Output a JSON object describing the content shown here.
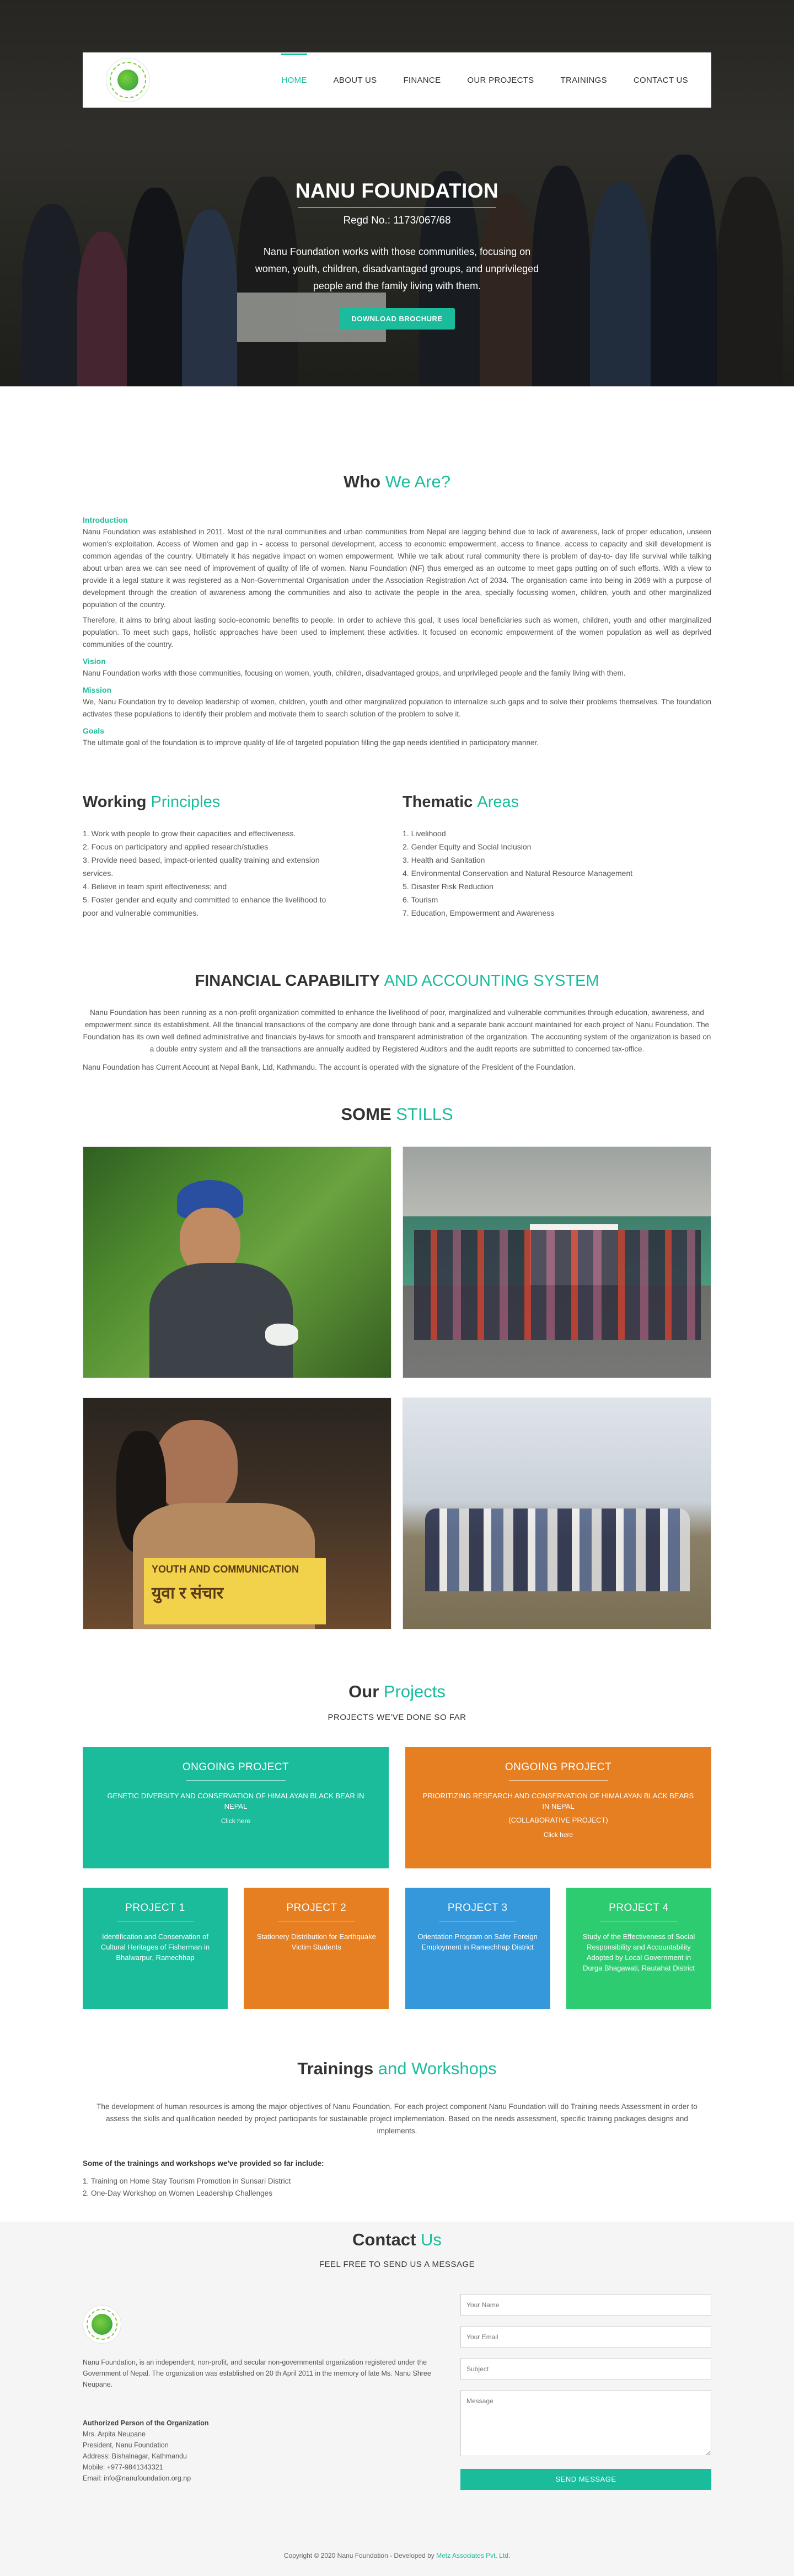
{
  "nav": {
    "items": [
      {
        "label": "HOME",
        "active": true
      },
      {
        "label": "ABOUT US",
        "active": false
      },
      {
        "label": "FINANCE",
        "active": false
      },
      {
        "label": "OUR PROJECTS",
        "active": false
      },
      {
        "label": "TRAININGS",
        "active": false
      },
      {
        "label": "CONTACT US",
        "active": false
      }
    ]
  },
  "hero": {
    "title": "NANU FOUNDATION",
    "regd": "Regd No.: 1173/067/68",
    "text": "Nanu Foundation works with those communities, focusing on women, youth, children, disadvantaged groups, and unprivileged people and the family living with them.",
    "button": "DOWNLOAD BROCHURE"
  },
  "who": {
    "title_a": "Who ",
    "title_b": "We Are?",
    "intro_h": "Introduction",
    "intro_p1": "Nanu Foundation was established in 2011. Most of the rural communities and urban communities from Nepal are lagging behind due to lack of awareness, lack of proper education, unseen women's exploitation. Access of Women and gap in - access to personal development, access to economic empowerment, access to finance, access to capacity and skill development is common agendas of the country. Ultimately it has negative impact on women empowerment. While we talk about rural community there is problem of day-to- day life survival while talking about urban area we can see need of improvement of quality of life of women. Nanu Foundation (NF) thus emerged as an outcome to meet gaps putting on of such efforts. With a view to provide it a legal stature it was registered as a Non-Governmental Organisation under the Association Registration Act of 2034. The organisation came into being in 2069 with a purpose of development through the creation of awareness among the communities and also to activate the people in the area, specially focussing women, children, youth and other marginalized population of the country.",
    "intro_p2": "Therefore, it aims to bring about lasting socio-economic benefits to people. In order to achieve this goal, it uses local beneficiaries such as women, children, youth and other marginalized population. To meet such gaps, holistic approaches have been used to implement these activities. It focused on economic empowerment of the women population as well as deprived communities of the country.",
    "vision_h": "Vision",
    "vision_p": "Nanu Foundation works with those communities, focusing on women, youth, children, disadvantaged groups, and unprivileged people and the family living with them.",
    "mission_h": "Mission",
    "mission_p": "We, Nanu Foundation try to develop leadership of women, children, youth and other marginalized population to internalize such gaps and to solve their problems themselves. The foundation activates these populations to identify their problem and motivate them to search solution of the problem to solve it.",
    "goals_h": "Goals",
    "goals_p": "The ultimate goal of the foundation is to improve quality of life of targeted population filling the gap needs identified in participatory manner."
  },
  "principles": {
    "title_a": "Working ",
    "title_b": "Principles",
    "items": [
      "1. Work with people to grow their capacities and effectiveness.",
      "2. Focus on participatory and applied research/studies",
      "3. Provide need based, impact-oriented quality training and extension services.",
      "4. Believe in team spirit effectiveness; and",
      "5. Foster gender and equity and committed to enhance the livelihood to poor and vulnerable communities."
    ]
  },
  "thematic": {
    "title_a": "Thematic ",
    "title_b": "Areas",
    "items": [
      "1. Livelihood",
      "2. Gender Equity and Social Inclusion",
      "3. Health and Sanitation",
      "4. Environmental Conservation and Natural Resource Management",
      "5. Disaster Risk Reduction",
      "6. Tourism",
      "7. Education, Empowerment and Awareness"
    ]
  },
  "finance": {
    "title_a": "FINANCIAL CAPABILITY ",
    "title_b": "AND ACCOUNTING SYSTEM",
    "p1": "Nanu Foundation has been running as a non-profit organization committed to enhance the livelihood of poor, marginalized and vulnerable communities through education, awareness, and empowerment since its establishment. All the financial transactions of the company are done through bank and a separate bank account maintained for each project of Nanu Foundation. The Foundation has its own well defined administrative and financials by-laws for smooth and transparent administration of the organization. The accounting system of the organization is based on a double entry system and all the transactions are annually audited by Registered Auditors and the audit reports are submitted to concerned tax-office.",
    "p2": "Nanu Foundation has Current Account at Nepal Bank, Ltd, Kathmandu. The account is operated with the signature of the President of the Foundation."
  },
  "stills": {
    "title_a": "SOME ",
    "title_b": "STILLS",
    "sign_text": "YOUTH AND COMMUNICATION",
    "sign_text2": "युवा र संचार"
  },
  "projects": {
    "title_a": "Our ",
    "title_b": "Projects",
    "subtitle": "PROJECTS WE'VE DONE SO FAR",
    "ongoing": [
      {
        "heading": "ONGOING PROJECT",
        "text": "GENETIC DIVERSITY AND CONSERVATION OF HIMALAYAN BLACK BEAR IN NEPAL",
        "extra": "",
        "link": "Click here",
        "color": "#1abc9c"
      },
      {
        "heading": "ONGOING PROJECT",
        "text": "PRIORITIZING RESEARCH AND CONSERVATION OF HIMALAYAN BLACK BEARS IN NEPAL",
        "extra": "(COLLABORATIVE PROJECT)",
        "link": "Click here",
        "color": "#e67e22"
      }
    ],
    "done": [
      {
        "heading": "PROJECT 1",
        "text": "Identification and Conservation of Cultural Heritages of Fisherman in Bhalwarpur, Ramechhap",
        "color": "#1abc9c"
      },
      {
        "heading": "PROJECT 2",
        "text": "Stationery Distribution for Earthquake Victim Students",
        "color": "#e67e22"
      },
      {
        "heading": "PROJECT 3",
        "text": "Orientation Program on Safer Foreign Employment in Ramechhap District",
        "color": "#3498db"
      },
      {
        "heading": "PROJECT 4",
        "text": "Study of the Effectiveness of Social Responsibility and Accountability Adopted by Local Government in Durga Bhagawati, Rautahat District",
        "color": "#2ecc71"
      }
    ]
  },
  "trainings": {
    "title_a": "Trainings ",
    "title_b": "and Workshops",
    "text": "The development of human resources is among the major objectives of Nanu Foundation. For each project component Nanu Foundation will do Training needs Assessment in order to assess the skills and qualification needed by project participants for sustainable project implementation. Based on the needs assessment, specific training packages designs and implements.",
    "list_title": "Some of the trainings and workshops we've provided so far include:",
    "items": [
      "1. Training on Home Stay Tourism Promotion in Sunsari District",
      "2. One-Day Workshop on Women Leadership Challenges"
    ]
  },
  "contact": {
    "title_a": "Contact ",
    "title_b": "Us",
    "subtitle": "FEEL FREE TO SEND US A MESSAGE",
    "about": "Nanu Foundation, is an independent, non-profit, and secular non-governmental organization registered under the Government of Nepal. The organization was established on 20 th April 2011 in the memory of late Ms. Nanu Shree Neupane.",
    "auth_title": "Authorized Person of the Organization",
    "auth_lines": [
      "Mrs. Arpita Neupane",
      "President, Nanu Foundation",
      "Address: Bishalnagar, Kathmandu",
      "Mobile: +977-9841343321",
      "Email: info@nanufoundation.org.np"
    ],
    "form": {
      "name": "Your Name",
      "email": "Your Email",
      "subject": "Subject",
      "message": "Message",
      "send": "SEND MESSAGE"
    }
  },
  "footer": {
    "text": "Copyright © 2020 Nanu Foundation - Developed by ",
    "dev": "Metz Associates Pvt. Ltd."
  },
  "colors": {
    "accent": "#1abc9c",
    "orange": "#e67e22",
    "blue": "#3498db",
    "green": "#2ecc71"
  }
}
